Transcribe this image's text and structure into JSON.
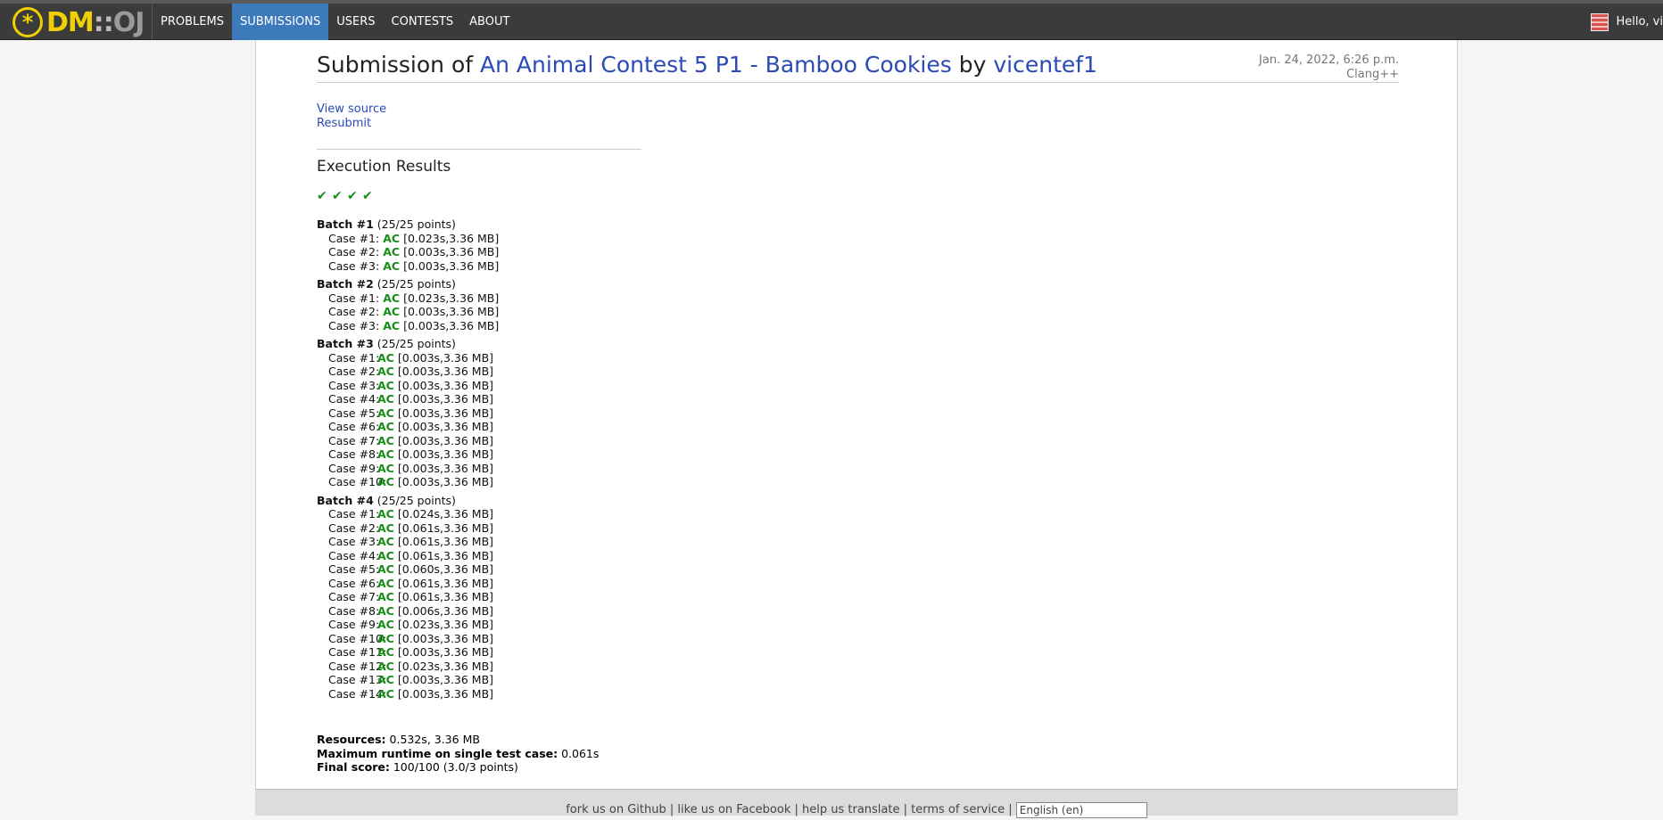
{
  "header": {
    "logo_dm": "DM",
    "logo_sep": "::",
    "logo_oj": "OJ",
    "nav": [
      "PROBLEMS",
      "SUBMISSIONS",
      "USERS",
      "CONTESTS",
      "ABOUT"
    ],
    "active_nav": "SUBMISSIONS",
    "greeting": "Hello, vi"
  },
  "submission": {
    "prefix": "Submission of",
    "problem": "An Animal Contest 5 P1 - Bamboo Cookies",
    "by": "by",
    "user": "vicentef1",
    "date": "Jan. 24, 2022, 6:26 p.m.",
    "language": "Clang++"
  },
  "links": {
    "view_source": "View source",
    "resubmit": "Resubmit"
  },
  "execution": {
    "title": "Execution Results",
    "checks": 4,
    "batches": [
      {
        "name": "Batch #1",
        "points": "(25/25 points)",
        "cases": [
          {
            "label": "Case #1:",
            "result": "AC",
            "stats": "[0.023s,3.36 MB]"
          },
          {
            "label": "Case #2:",
            "result": "AC",
            "stats": "[0.003s,3.36 MB]"
          },
          {
            "label": "Case #3:",
            "result": "AC",
            "stats": "[0.003s,3.36 MB]"
          }
        ]
      },
      {
        "name": "Batch #2",
        "points": "(25/25 points)",
        "cases": [
          {
            "label": "Case #1:",
            "result": "AC",
            "stats": "[0.023s,3.36 MB]"
          },
          {
            "label": "Case #2:",
            "result": "AC",
            "stats": "[0.003s,3.36 MB]"
          },
          {
            "label": "Case #3:",
            "result": "AC",
            "stats": "[0.003s,3.36 MB]"
          }
        ]
      },
      {
        "name": "Batch #3",
        "points": "(25/25 points)",
        "cases": [
          {
            "label": "Case #1:",
            "result": "AC",
            "stats": "[0.003s,3.36 MB]"
          },
          {
            "label": "Case #2:",
            "result": "AC",
            "stats": "[0.003s,3.36 MB]"
          },
          {
            "label": "Case #3:",
            "result": "AC",
            "stats": "[0.003s,3.36 MB]"
          },
          {
            "label": "Case #4:",
            "result": "AC",
            "stats": "[0.003s,3.36 MB]"
          },
          {
            "label": "Case #5:",
            "result": "AC",
            "stats": "[0.003s,3.36 MB]"
          },
          {
            "label": "Case #6:",
            "result": "AC",
            "stats": "[0.003s,3.36 MB]"
          },
          {
            "label": "Case #7:",
            "result": "AC",
            "stats": "[0.003s,3.36 MB]"
          },
          {
            "label": "Case #8:",
            "result": "AC",
            "stats": "[0.003s,3.36 MB]"
          },
          {
            "label": "Case #9:",
            "result": "AC",
            "stats": "[0.003s,3.36 MB]"
          },
          {
            "label": "Case #10:",
            "result": "AC",
            "stats": "[0.003s,3.36 MB]"
          }
        ]
      },
      {
        "name": "Batch #4",
        "points": "(25/25 points)",
        "cases": [
          {
            "label": "Case #1:",
            "result": "AC",
            "stats": "[0.024s,3.36 MB]"
          },
          {
            "label": "Case #2:",
            "result": "AC",
            "stats": "[0.061s,3.36 MB]"
          },
          {
            "label": "Case #3:",
            "result": "AC",
            "stats": "[0.061s,3.36 MB]"
          },
          {
            "label": "Case #4:",
            "result": "AC",
            "stats": "[0.061s,3.36 MB]"
          },
          {
            "label": "Case #5:",
            "result": "AC",
            "stats": "[0.060s,3.36 MB]"
          },
          {
            "label": "Case #6:",
            "result": "AC",
            "stats": "[0.061s,3.36 MB]"
          },
          {
            "label": "Case #7:",
            "result": "AC",
            "stats": "[0.061s,3.36 MB]"
          },
          {
            "label": "Case #8:",
            "result": "AC",
            "stats": "[0.006s,3.36 MB]"
          },
          {
            "label": "Case #9:",
            "result": "AC",
            "stats": "[0.023s,3.36 MB]"
          },
          {
            "label": "Case #10:",
            "result": "AC",
            "stats": "[0.003s,3.36 MB]"
          },
          {
            "label": "Case #11:",
            "result": "AC",
            "stats": "[0.003s,3.36 MB]"
          },
          {
            "label": "Case #12:",
            "result": "AC",
            "stats": "[0.023s,3.36 MB]"
          },
          {
            "label": "Case #13:",
            "result": "AC",
            "stats": "[0.003s,3.36 MB]"
          },
          {
            "label": "Case #14:",
            "result": "AC",
            "stats": "[0.003s,3.36 MB]"
          }
        ]
      }
    ]
  },
  "summary": {
    "resources_label": "Resources:",
    "resources": "0.532s, 3.36 MB",
    "max_runtime_label": "Maximum runtime on single test case:",
    "max_runtime": "0.061s",
    "final_score_label": "Final score:",
    "final_score": "100/100 (3.0/3 points)"
  },
  "footer": {
    "text": "fork us on Github | like us on Facebook | help us translate | terms of service |",
    "language": "English (en)"
  },
  "colors": {
    "accent": "#3d7abc",
    "link": "#2b4ab5",
    "ac": "#1a8c1a",
    "logo": "#f0d000"
  }
}
